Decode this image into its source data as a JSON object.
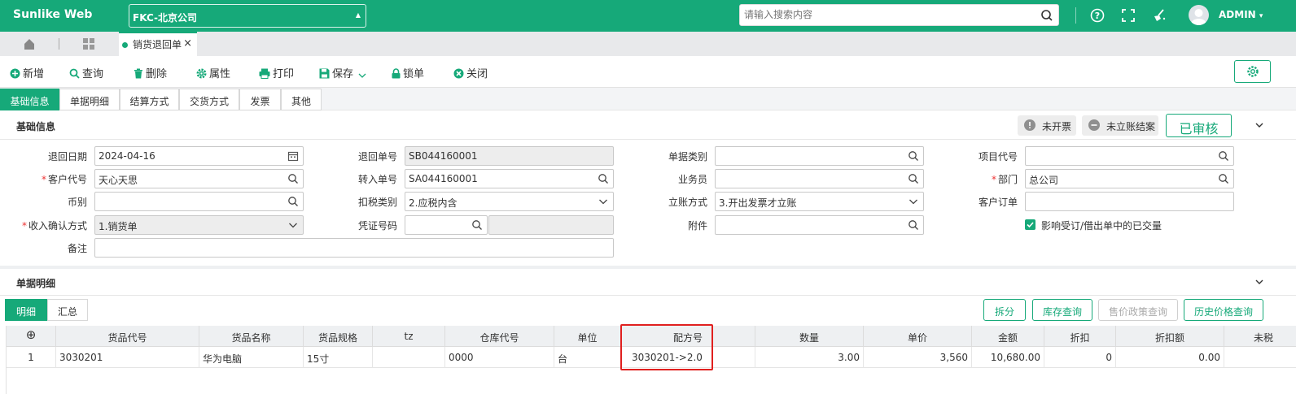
{
  "header": {
    "brand": "Sunlike Web",
    "company": "FKC-北京公司",
    "search_placeholder": "请输入搜索内容",
    "username": "ADMIN",
    "username_caret": "▾"
  },
  "tabs": {
    "open_doc": "销货退回单",
    "close_glyph": "×"
  },
  "toolbar": {
    "new": "新增",
    "query": "查询",
    "delete": "删除",
    "properties": "属性",
    "print": "打印",
    "save": "保存",
    "lock": "锁单",
    "close": "关闭"
  },
  "section_tabs": [
    "基础信息",
    "单据明细",
    "结算方式",
    "交货方式",
    "发票",
    "其他"
  ],
  "basic": {
    "title": "基础信息",
    "badge_invoice": "未开票",
    "badge_account": "未立账结案",
    "status": "已审核",
    "fields": {
      "return_date": {
        "label": "退回日期",
        "value": "2024-04-16"
      },
      "customer": {
        "label": "客户代号",
        "value": "天心天思"
      },
      "currency": {
        "label": "币别",
        "value": ""
      },
      "income_confirm": {
        "label": "收入确认方式",
        "value": "1.销货单"
      },
      "remark": {
        "label": "备注",
        "value": ""
      },
      "return_no": {
        "label": "退回单号",
        "value": "SB044160001"
      },
      "transfer_no": {
        "label": "转入单号",
        "value": "SA044160001"
      },
      "tax_type": {
        "label": "扣税类别",
        "value": "2.应税内含"
      },
      "voucher_no": {
        "label": "凭证号码",
        "value": ""
      },
      "doc_category": {
        "label": "单据类别",
        "value": ""
      },
      "salesperson": {
        "label": "业务员",
        "value": ""
      },
      "account_method": {
        "label": "立账方式",
        "value": "3.开出发票才立账"
      },
      "attachment": {
        "label": "附件",
        "value": ""
      },
      "project_code": {
        "label": "项目代号",
        "value": ""
      },
      "department": {
        "label": "部门",
        "value": "总公司"
      },
      "customer_order": {
        "label": "客户订单",
        "value": ""
      },
      "affect_qty": {
        "label": "影响受订/借出单中的已交量",
        "checked": true
      }
    }
  },
  "detail": {
    "title": "单据明细",
    "tabs": [
      "明细",
      "汇总"
    ],
    "buttons": {
      "split": "拆分",
      "stock_query": "库存查询",
      "price_policy": "售价政策查询",
      "price_history": "历史价格查询"
    },
    "add_glyph": "⊕",
    "columns": [
      "货品代号",
      "货品名称",
      "货品规格",
      "tz",
      "仓库代号",
      "单位",
      "配方号",
      "数量",
      "单价",
      "金额",
      "折扣",
      "折扣额",
      "未税"
    ],
    "rows": [
      {
        "no": "1",
        "code": "3030201",
        "name": "华为电脑",
        "spec": "15寸",
        "tz": "",
        "warehouse": "0000",
        "unit": "台",
        "formula": "3030201->2.0",
        "qty": "3.00",
        "price": "3,560",
        "amount": "10,680.00",
        "discount": "0",
        "discount_amt": "0.00",
        "untaxed": ""
      }
    ]
  },
  "colors": {
    "primary": "#16a979",
    "highlight": "#e0201f"
  }
}
